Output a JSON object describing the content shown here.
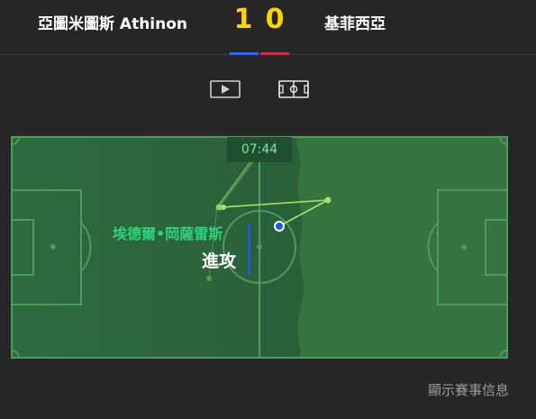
{
  "match": {
    "home_team": "亞圖米圖斯 Athinon",
    "away_team": "基菲西亞",
    "home_score": "1",
    "away_score": "0",
    "home_color": "#2f6bd6",
    "away_color": "#c63242"
  },
  "media_toggle": {
    "video_icon": "play-icon",
    "field_icon": "pitch-icon"
  },
  "live_event": {
    "clock": "07:44",
    "player": "埃德爾•岡薩雷斯",
    "action": "進攻",
    "team_color": "#1e5bd8"
  },
  "footer": {
    "match_info_label": "顯示賽事信息"
  }
}
